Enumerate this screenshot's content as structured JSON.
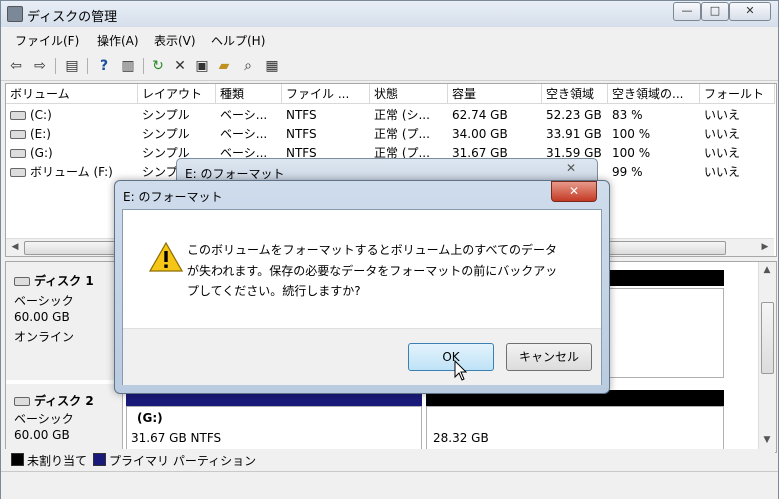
{
  "window": {
    "title": "ディスクの管理",
    "controls": {
      "minimize": "—",
      "maximize": "□",
      "close": "✕"
    }
  },
  "menu": [
    "ファイル(F)",
    "操作(A)",
    "表示(V)",
    "ヘルプ(H)"
  ],
  "toolbar": {
    "icons": [
      "back-icon",
      "forward-icon",
      "properties-icon",
      "help-icon",
      "console-tree-icon",
      "refresh-icon",
      "delete-icon",
      "rescan-icon",
      "open-icon",
      "search-icon",
      "settings-icon"
    ],
    "glyphs": [
      "⇦",
      "⇨",
      "▤",
      "?",
      "▥",
      "↻",
      "✕",
      "▣",
      "▰",
      "⌕",
      "▦"
    ]
  },
  "volume_table": {
    "headers": [
      "ボリューム",
      "レイアウト",
      "種類",
      "ファイル ...",
      "状態",
      "容量",
      "空き領域",
      "空き領域の...",
      "フォールト"
    ],
    "rows": [
      [
        "(C:)",
        "シンプル",
        "ベーシ...",
        "NTFS",
        "正常 (シ...",
        "62.74 GB",
        "52.23 GB",
        "83 %",
        "いいえ"
      ],
      [
        "(E:)",
        "シンプル",
        "ベーシ...",
        "NTFS",
        "正常 (プ...",
        "34.00 GB",
        "33.91 GB",
        "100 %",
        "いいえ"
      ],
      [
        "(G:)",
        "シンプル",
        "ベーシ...",
        "NTFS",
        "正常 (プ...",
        "31.67 GB",
        "31.59 GB",
        "100 %",
        "いいえ"
      ],
      [
        "ボリューム (F:)",
        "シンプ",
        "",
        "",
        "",
        "",
        "",
        "99 %",
        "いいえ"
      ]
    ]
  },
  "disks": [
    {
      "name": "ディスク 1",
      "type": "ベーシック",
      "size": "60.00 GB",
      "status": "オンライン"
    },
    {
      "name": "ディスク 2",
      "type": "ベーシック",
      "size": "60.00 GB",
      "partitions": [
        {
          "name": "(G:)",
          "info": "31.67 GB NTFS"
        },
        {
          "name": "",
          "info": "28.32 GB"
        }
      ]
    }
  ],
  "legend": [
    {
      "label": "未割り当て",
      "color": "#000000"
    },
    {
      "label": "プライマリ パーティション",
      "color": "#1a1a7a"
    }
  ],
  "background_dialog": {
    "title": "E: のフォーマット",
    "close": "✕"
  },
  "dialog": {
    "title": "E: のフォーマット",
    "close": "✕",
    "warning_icon": "warning-icon",
    "message_lines": [
      "このボリュームをフォーマットするとボリューム上のすべてのデータ",
      "が失われます。保存の必要なデータをフォーマットの前にバックアッ",
      "プしてください。続行しますか?"
    ],
    "ok_label": "OK",
    "cancel_label": "キャンセル"
  }
}
